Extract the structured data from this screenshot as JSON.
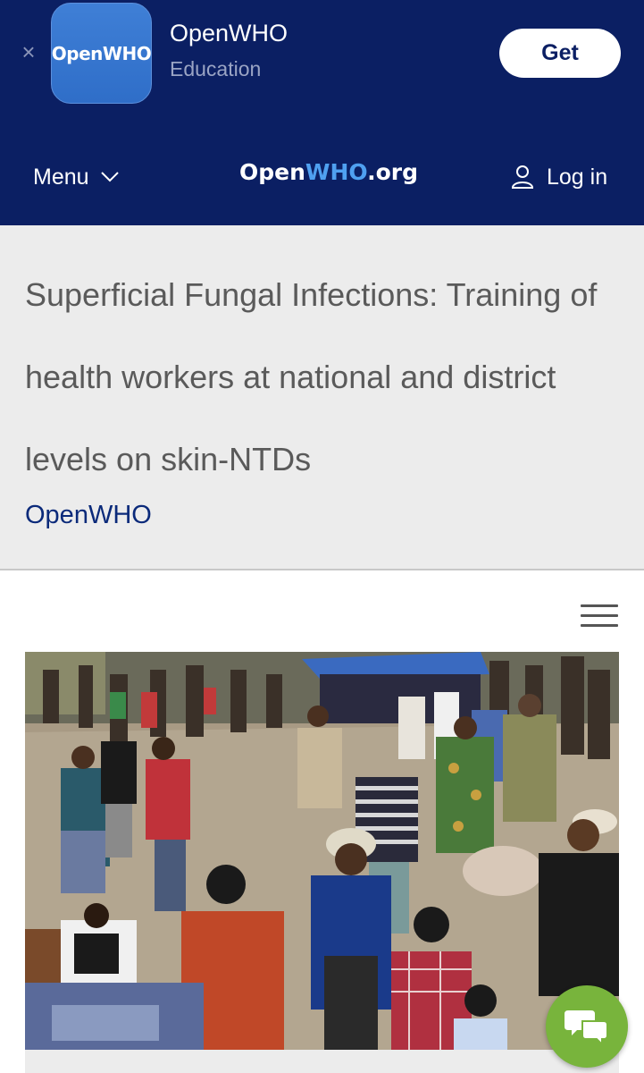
{
  "app_banner": {
    "close_glyph": "×",
    "icon_text": "OpenWHO",
    "app_name": "OpenWHO",
    "category": "Education",
    "get_label": "Get"
  },
  "navbar": {
    "menu_label": "Menu",
    "logo_open": "Open",
    "logo_who": "WHO",
    "logo_org": ".org",
    "login_label": "Log in"
  },
  "course": {
    "title": "Superficial Fungal Infections: Training of health workers at national and district levels on skin-NTDs",
    "provider": "OpenWHO"
  },
  "colors": {
    "brand_navy": "#0b1f63",
    "logo_accent": "#4fa0f0",
    "chat_green": "#78b43c",
    "header_bg": "#ececec"
  },
  "icons": [
    "close-icon",
    "chevron-down-icon",
    "user-icon",
    "hamburger-menu-icon",
    "chat-icon"
  ]
}
